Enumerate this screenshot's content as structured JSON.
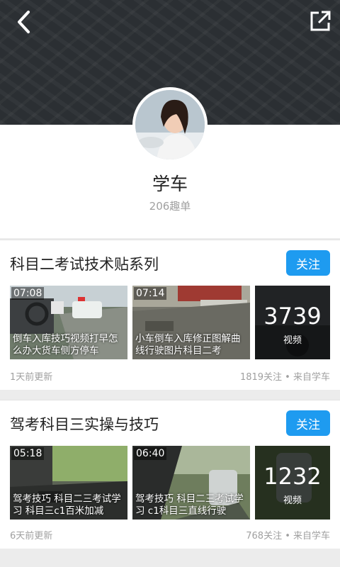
{
  "header": {
    "back_icon": "chevron-left-icon",
    "share_icon": "share-external-icon"
  },
  "profile": {
    "name": "学车",
    "followers": "206趣单"
  },
  "series": [
    {
      "title": "科目二考试技术贴系列",
      "follow_label": "关注",
      "videos": [
        {
          "duration": "07:08",
          "title": "倒车入库技巧视频打早怎么办大货车侧方停车"
        },
        {
          "duration": "07:14",
          "title": "小车倒车入库修正图解曲线行驶图片科目二考"
        }
      ],
      "video_count": "3739",
      "video_count_label": "视频",
      "updated": "1天前更新",
      "meta": "1819关注 • 来自学车"
    },
    {
      "title": "驾考科目三实操与技巧",
      "follow_label": "关注",
      "videos": [
        {
          "duration": "05:18",
          "title": "驾考技巧 科目二三考试学习 科目三c1百米加减"
        },
        {
          "duration": "06:40",
          "title": "驾考技巧 科目二三考试学习 c1科目三直线行驶"
        }
      ],
      "video_count": "1232",
      "video_count_label": "视频",
      "updated": "6天前更新",
      "meta": "768关注 • 来自学车"
    }
  ],
  "colors": {
    "accent": "#1e9bf0",
    "banner": "#2b2f33",
    "muted": "#a0a0a0"
  }
}
